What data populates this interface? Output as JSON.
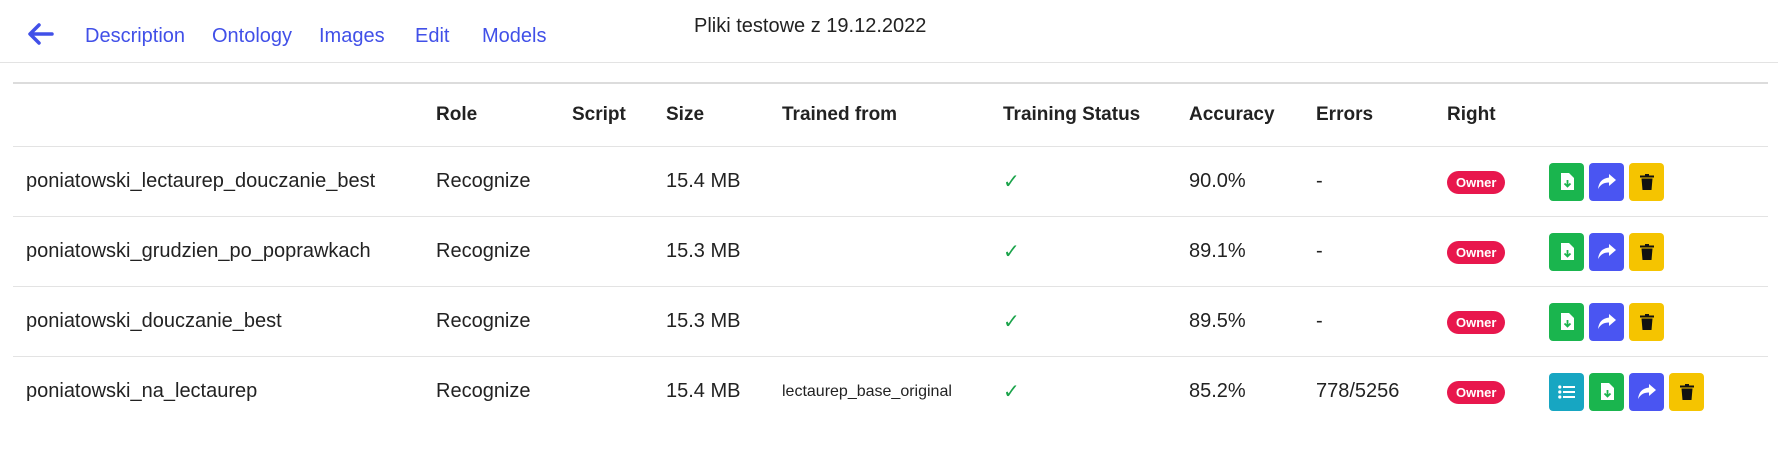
{
  "nav": {
    "tabs": [
      {
        "label": "Description"
      },
      {
        "label": "Ontology"
      },
      {
        "label": "Images"
      },
      {
        "label": "Edit"
      },
      {
        "label": "Models"
      }
    ],
    "title": "Pliki testowe z 19.12.2022",
    "back_icon": "arrow-left-icon"
  },
  "table": {
    "headers": {
      "role": "Role",
      "script": "Script",
      "size": "Size",
      "trained_from": "Trained from",
      "training_status": "Training Status",
      "accuracy": "Accuracy",
      "errors": "Errors",
      "right": "Right"
    },
    "rows": [
      {
        "name": "poniatowski_lectaurep_douczanie_best",
        "role": "Recognize",
        "script": "",
        "size": "15.4 MB",
        "trained_from": "",
        "status": "✓",
        "accuracy": "90.0%",
        "errors": "-",
        "right": "Owner"
      },
      {
        "name": "poniatowski_grudzien_po_poprawkach",
        "role": "Recognize",
        "script": "",
        "size": "15.3 MB",
        "trained_from": "",
        "status": "✓",
        "accuracy": "89.1%",
        "errors": "-",
        "right": "Owner"
      },
      {
        "name": "poniatowski_douczanie_best",
        "role": "Recognize",
        "script": "",
        "size": "15.3 MB",
        "trained_from": "",
        "status": "✓",
        "accuracy": "89.5%",
        "errors": "-",
        "right": "Owner"
      },
      {
        "name": "poniatowski_na_lectaurep",
        "role": "Recognize",
        "script": "",
        "size": "15.4 MB",
        "trained_from": "lectaurep_base_original",
        "status": "✓",
        "accuracy": "85.2%",
        "errors": "778/5256",
        "right": "Owner"
      }
    ]
  },
  "colors": {
    "accent": "#4150e8",
    "download": "#1ab54e",
    "share": "#4a55f2",
    "delete": "#f5c400",
    "details": "#17a6c2",
    "owner_badge": "#e8174d",
    "status_ok": "#1aa34a"
  },
  "icons": {
    "download": "file-download-icon",
    "share": "share-arrow-icon",
    "delete": "trash-icon",
    "details": "list-icon"
  }
}
